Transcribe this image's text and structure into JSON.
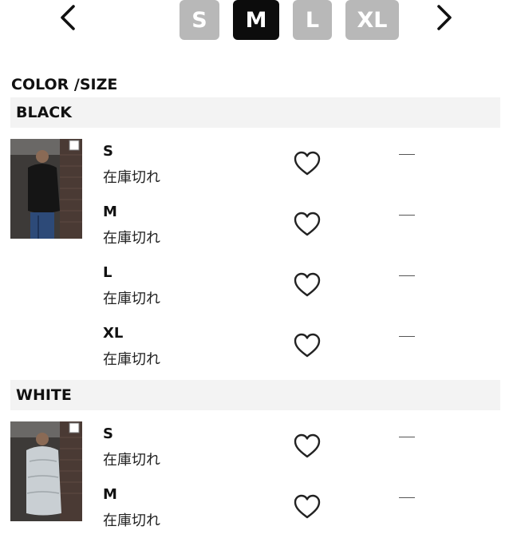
{
  "nav": {
    "prev_icon": "chevron-left-icon",
    "next_icon": "chevron-right-icon",
    "sizes": [
      {
        "label": "S",
        "active": false
      },
      {
        "label": "M",
        "active": true
      },
      {
        "label": "L",
        "active": false
      },
      {
        "label": "XL",
        "active": false
      }
    ]
  },
  "section_title": "COLOR /SIZE",
  "colors": [
    {
      "name": "BLACK",
      "image": "product-photo-black-down-jacket",
      "rows": [
        {
          "size": "S",
          "status": "在庫切れ",
          "price": "—"
        },
        {
          "size": "M",
          "status": "在庫切れ",
          "price": "—"
        },
        {
          "size": "L",
          "status": "在庫切れ",
          "price": "—"
        },
        {
          "size": "XL",
          "status": "在庫切れ",
          "price": "—"
        }
      ]
    },
    {
      "name": "WHITE",
      "image": "product-photo-white-down-jacket",
      "rows": [
        {
          "size": "S",
          "status": "在庫切れ",
          "price": "—"
        },
        {
          "size": "M",
          "status": "在庫切れ",
          "price": "—"
        }
      ]
    }
  ],
  "colors_theme": {
    "active_tab": "#0c0c0c",
    "inactive_tab": "#b8b8b8",
    "bar_bg": "#f3f3f3"
  }
}
